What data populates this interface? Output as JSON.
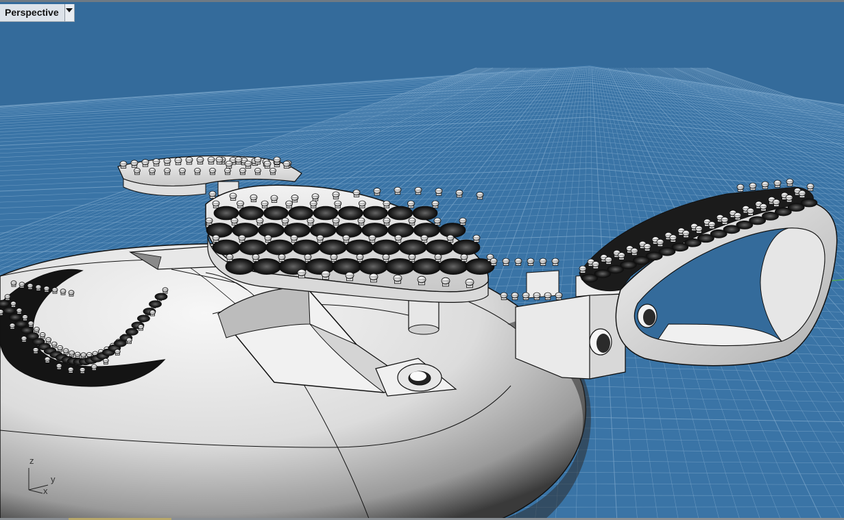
{
  "viewport": {
    "title": "Perspective",
    "menu_icon": "dropdown-arrow-icon",
    "background_color": "#346b9b",
    "grid_color": "#7fa8cb",
    "axis_x_color": "#c9503f",
    "axis_y_color": "#4fae48"
  },
  "axes_widget": {
    "z_label": "z",
    "y_label": "y",
    "x_label": "x"
  },
  "model": {
    "surface_color": "#ececec",
    "edge_color": "#111111",
    "parts": [
      "base-dome",
      "pave-crescent",
      "upper-plate",
      "upper-tip",
      "bail-link",
      "bail-loop",
      "side-pave"
    ]
  }
}
